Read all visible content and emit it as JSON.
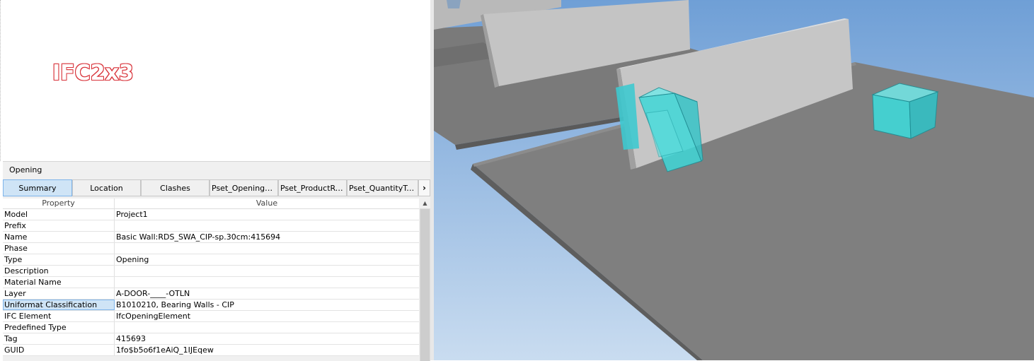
{
  "overlay_label": "IFC2x3",
  "panel": {
    "title": "Opening",
    "tabs": [
      {
        "label": "Summary",
        "active": true
      },
      {
        "label": "Location",
        "active": false
      },
      {
        "label": "Clashes",
        "active": false
      },
      {
        "label": "Pset_OpeningEle...",
        "active": false
      },
      {
        "label": "Pset_ProductReq...",
        "active": false
      },
      {
        "label": "Pset_QuantityTak...",
        "active": false
      }
    ],
    "scroll_glyph": "›",
    "columns": {
      "property": "Property",
      "value": "Value"
    },
    "rows": [
      {
        "property": "Model",
        "value": "Project1"
      },
      {
        "property": "Prefix",
        "value": ""
      },
      {
        "property": "Name",
        "value": "Basic Wall:RDS_SWA_CIP-sp.30cm:415694"
      },
      {
        "property": "Phase",
        "value": ""
      },
      {
        "property": "Type",
        "value": "Opening"
      },
      {
        "property": "Description",
        "value": ""
      },
      {
        "property": "Material Name",
        "value": ""
      },
      {
        "property": "Layer",
        "value": "A-DOOR-____-OTLN"
      },
      {
        "property": "Uniformat Classification",
        "value": "B1010210, Bearing Walls - CIP"
      },
      {
        "property": "IFC Element",
        "value": "IfcOpeningElement"
      },
      {
        "property": "Predefined Type",
        "value": ""
      },
      {
        "property": "Tag",
        "value": "415693"
      },
      {
        "property": "GUID",
        "value": "1fo$b5o6f1eAiQ_1IJEqew"
      }
    ],
    "selected_row": "Uniformat Classification"
  },
  "viewport": {
    "sky_top": "#6f9fd6",
    "sky_bottom": "#c9dcf0",
    "slab_color": "#808080",
    "wall_color": "#c8c8c8",
    "opening_color": "#3fd8d8"
  }
}
